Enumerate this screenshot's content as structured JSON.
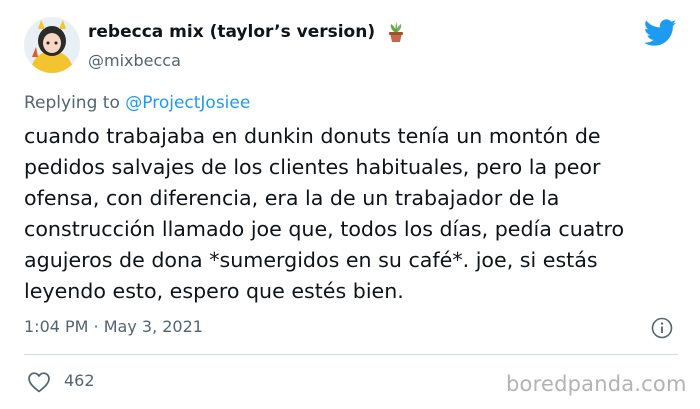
{
  "user": {
    "display_name": "rebecca mix (taylor’s version)",
    "handle": "@mixbecca",
    "avatar_icon": "avatar-illustration",
    "name_emoji_icon": "potted-plant-icon"
  },
  "brand": {
    "icon": "twitter-bird-icon",
    "color": "#1d9bf0"
  },
  "reply": {
    "prefix": "Replying to",
    "mention": "@ProjectJosiee"
  },
  "tweet": {
    "lines": [
      "cuando trabajaba en dunkin donuts tenía un montón de",
      "pedidos salvajes de los clientes habituales, pero la peor",
      "ofensa, con diferencia, era la de un trabajador de la",
      "construcción llamado joe que, todos los días, pedía cuatro",
      "agujeros de dona *sumergidos en su café*. joe, si estás",
      "leyendo esto, espero que estés bien."
    ],
    "timestamp": "1:04 PM · May 3, 2021",
    "like_count": "462"
  },
  "watermark": "boredpanda.com"
}
